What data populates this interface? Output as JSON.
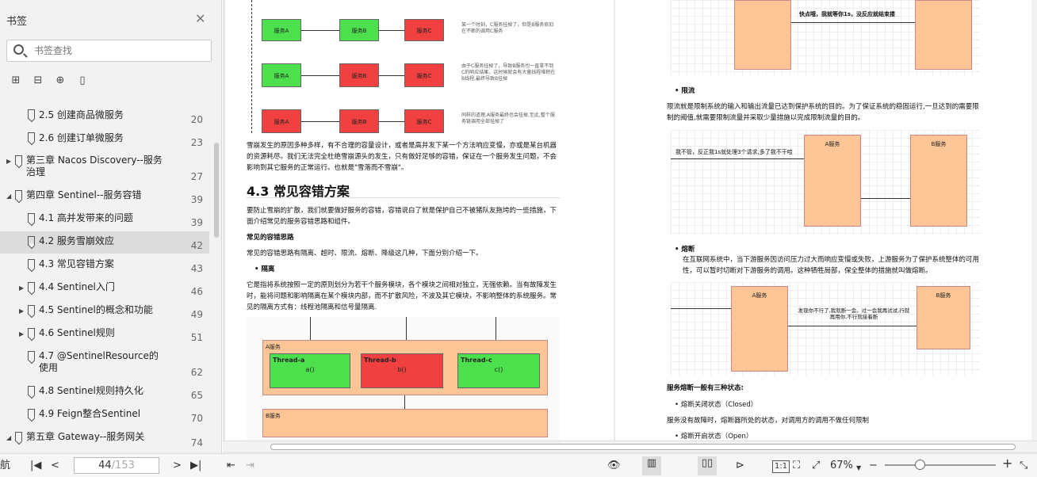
{
  "sidebar": {
    "title": "书签",
    "search_placeholder": "书签查找",
    "items": [
      {
        "label": "2.5 创建商品微服务",
        "page": "20"
      },
      {
        "label": "2.6 创建订单微服务",
        "page": "23"
      },
      {
        "label": "第三章 Nacos Discovery--服务治理",
        "page": "27"
      },
      {
        "label": "第四章 Sentinel--服务容错",
        "page": "39"
      },
      {
        "label": "4.1 高并发带来的问题",
        "page": "39"
      },
      {
        "label": "4.2 服务雪崩效应",
        "page": "42"
      },
      {
        "label": "4.3 常见容错方案",
        "page": "43"
      },
      {
        "label": "4.4 Sentinel入门",
        "page": "46"
      },
      {
        "label": "4.5 Sentinel的概念和功能",
        "page": "49"
      },
      {
        "label": "4.6 Sentinel规则",
        "page": "51"
      },
      {
        "label": "4.7 @SentinelResource的使用",
        "page": "62"
      },
      {
        "label": "4.8 Sentinel规则持久化",
        "page": "65"
      },
      {
        "label": "4.9 Feign整合Sentinel",
        "page": "70"
      },
      {
        "label": "第五章 Gateway--服务网关",
        "page": "74"
      }
    ]
  },
  "doc_left": {
    "svc_a": "服务A",
    "svc_b": "服务B",
    "svc_c": "服务C",
    "note1": "某一个时刻，C服务挂掉了，但是B服务依旧在不断的调用C服务",
    "note2": "由于C服务挂掉了，导致B服务也一直拿不到C的响应结果，这时候就会有大量线程堆积在B线程,最终导致B挂掉",
    "note3": "同样的道理,A服务最终也会挂掉,至此,整个服务链调用全部挂掉了",
    "para1": "雪崩发生的原因多种多样，有不合理的容量设计，或者是高并发下某一个方法响应变慢，亦或是某台机器的资源耗尽。我们无法完全杜绝雪崩源头的发生，只有做好足够的容错，保证在一个服务发生问题，不会影响到其它服务的正常运行。也就是\"雪落而不雪崩\"。",
    "heading": "4.3 常见容错方案",
    "para2": "要防止雪崩的扩散，我们就要做好服务的容错，容错说白了就是保护自己不被猪队友拖垮的一些措施，下面介绍常见的服务容错思路和组件。",
    "sub": "常见的容错思路",
    "para3": "常见的容错思路有隔离、超时、限流、熔断、降级这几种，下面分别介绍一下。",
    "bullet": "隔离",
    "para4": "它是指将系统按照一定的原则划分为若干个服务模块，各个模块之间相对独立，无强依赖。当有故障发生时，能将问题和影响隔离在某个模块内部，而不扩散风险，不波及其它模块，不影响整体的系统服务。常见的隔离方式有：线程池隔离和信号量隔离.",
    "a_svc": "A服务",
    "b_svc": "B服务",
    "thread_a": "Thread-a",
    "thread_b": "Thread-b",
    "thread_c": "Thread-c",
    "fa": "a()",
    "fb": "b()",
    "fc": "c()"
  },
  "doc_right": {
    "top_note": "快点哦，我就等你1s，没反应就结束搂",
    "bullet1": "限流",
    "para1": "限流就是限制系统的输入和输出流量已达到保护系统的目的。为了保证系统的稳固运行,一旦达到的需要限制的阈值,就需要限制流量并采取少量措施以完成限制流量的目的。",
    "limit_note": "我不管，反正我1s就处理3个请求,多了我不干哈",
    "a_svc": "A服务",
    "b_svc": "B服务",
    "bullet2": "熔断",
    "para2": "在互联网系统中，当下游服务因访问压力过大而响应变慢或失败，上游服务为了保护系统整体的可用性，可以暂时切断对下游服务的调用。这种牺牲局部，保全整体的措施就叫做熔断。",
    "fuse_note": "发现你不行了,我就断一会。过一会我再试试,行就再用你,不行就接着断",
    "states_heading": "服务熔断一般有三种状态:",
    "state1": "熔断关闭状态（Closed）",
    "state1_desc": "服务没有故障时，熔断器所处的状态，对调用方的调用不做任何限制",
    "state2": "熔断开启状态（Open）"
  },
  "statusbar": {
    "nav_label": "航",
    "current_page": "44",
    "total_pages": "/153",
    "zoom": "67%",
    "ratio_label": "1:1"
  }
}
